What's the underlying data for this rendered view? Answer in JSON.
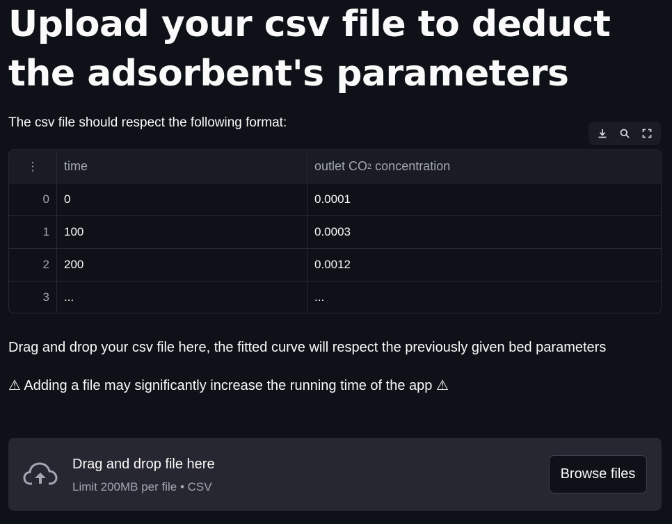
{
  "page": {
    "title": "Upload your csv file to deduct the adsorbent's parameters",
    "intro": "The csv file should respect the following format:",
    "drag_text": "Drag and drop your csv file here, the fitted curve will respect the previously given bed parameters",
    "warning_text": "⚠ Adding a file may significantly increase the running time of the app ⚠"
  },
  "toolbar": {
    "icons": [
      "download-icon",
      "search-icon",
      "fullscreen-icon"
    ]
  },
  "table": {
    "columns": {
      "index_menu": "⋮",
      "time": "time",
      "conc_prefix": "outlet CO",
      "conc_sub": "2",
      "conc_suffix": " concentration"
    },
    "rows": [
      {
        "index": "0",
        "time": "0",
        "conc": "0.0001"
      },
      {
        "index": "1",
        "time": "100",
        "conc": "0.0003"
      },
      {
        "index": "2",
        "time": "200",
        "conc": "0.0012"
      },
      {
        "index": "3",
        "time": "...",
        "conc": "..."
      }
    ]
  },
  "uploader": {
    "icon": "cloud-upload-icon",
    "title": "Drag and drop file here",
    "subtitle": "Limit 200MB per file • CSV",
    "button_label": "Browse files"
  },
  "colors": {
    "background": "#0e1117",
    "surface": "#262730",
    "text": "#fafafa",
    "muted": "#a3a8b4"
  }
}
